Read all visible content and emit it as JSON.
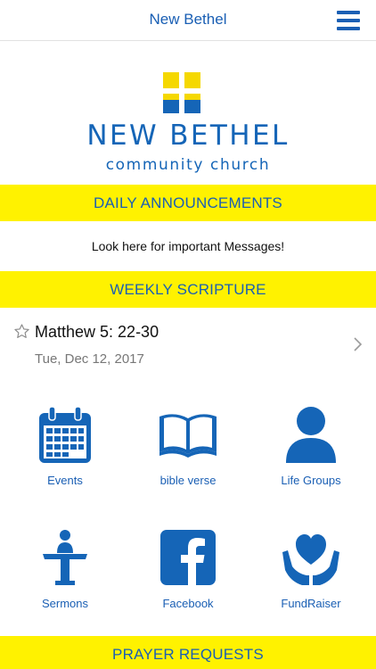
{
  "header": {
    "title": "New Bethel",
    "menu_icon": "hamburger-menu-icon"
  },
  "logo": {
    "name": "NEW BETHEL",
    "subtitle": "community church",
    "cross_colors": [
      "#f5d800",
      "#1565b7"
    ]
  },
  "announcements": {
    "heading": "DAILY ANNOUNCEMENTS",
    "message": "Look here for important Messages!"
  },
  "scripture": {
    "heading": "WEEKLY SCRIPTURE",
    "reference": "Matthew 5: 22-30",
    "date": "Tue, Dec 12, 2017"
  },
  "tiles": [
    {
      "label": "Events",
      "icon": "calendar-icon"
    },
    {
      "label": "bible verse",
      "icon": "open-bible-icon"
    },
    {
      "label": "Life Groups",
      "icon": "person-icon"
    },
    {
      "label": "Sermons",
      "icon": "preacher-podium-icon"
    },
    {
      "label": "Facebook",
      "icon": "facebook-icon"
    },
    {
      "label": "FundRaiser",
      "icon": "heart-in-hands-icon"
    }
  ],
  "prayer": {
    "heading": "PRAYER REQUESTS"
  },
  "colors": {
    "accent": "#1a5fb4",
    "band": "#fff200"
  }
}
